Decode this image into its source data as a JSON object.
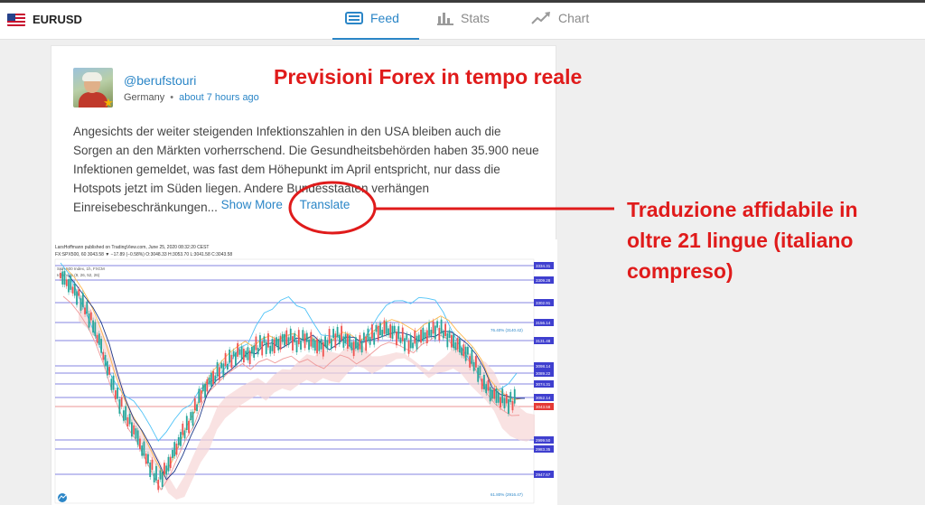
{
  "header": {
    "symbol": "EURUSD",
    "tabs": [
      {
        "label": "Feed",
        "icon": "feed-icon",
        "active": true
      },
      {
        "label": "Stats",
        "icon": "stats-icon",
        "active": false
      },
      {
        "label": "Chart",
        "icon": "chart-icon",
        "active": false
      }
    ]
  },
  "post": {
    "handle": "@berufstouri",
    "country": "Germany",
    "time": "about 7 hours ago",
    "text": "Angesichts der weiter steigenden Infektionszahlen in den USA bleiben auch die Sorgen an den Märkten vorherrschend. Die Gesundheitsbehörden haben 35.900 neue Infektionen gemeldet, was fast dem Höhepunkt im April entspricht, nur dass die Hotspots jetzt im Süden liegen. Andere Bundesstaaten verhängen Einreisebeschränkungen...",
    "show_more": "Show More",
    "translate": "Translate",
    "chart_header": "LarsHoffmann published on TradingView.com, June 25, 2020 08:32:20 CEST",
    "chart_ohlc": "FX:SPX500, 60 3043.58 ▼ −17.89 (−0.58%) O:3048.33 H:3053.70 L:3041.58 C:3043.58",
    "chart_series": "S&P 500 Index, 1h, FXCM",
    "chart_indicator": "Ichimoku (9, 26, 52, 26)",
    "price_labels": [
      "3334.31",
      "3309.28",
      "3302.91",
      "3156.14",
      "3131.48",
      "3098.14",
      "3089.22",
      "3074.31",
      "3052.14",
      "3043.58",
      "2999.50",
      "2983.35",
      "2947.67"
    ],
    "fib_labels": [
      "76.40% (3140.42)",
      "61.80% (2916.47)"
    ]
  },
  "annotations": {
    "title": "Previsioni Forex in tempo reale",
    "note": "Traduzione affidabile in oltre 21 lingue (italiano compreso)",
    "color": "#e01b1b"
  },
  "colors": {
    "accent": "#2b86c7"
  }
}
